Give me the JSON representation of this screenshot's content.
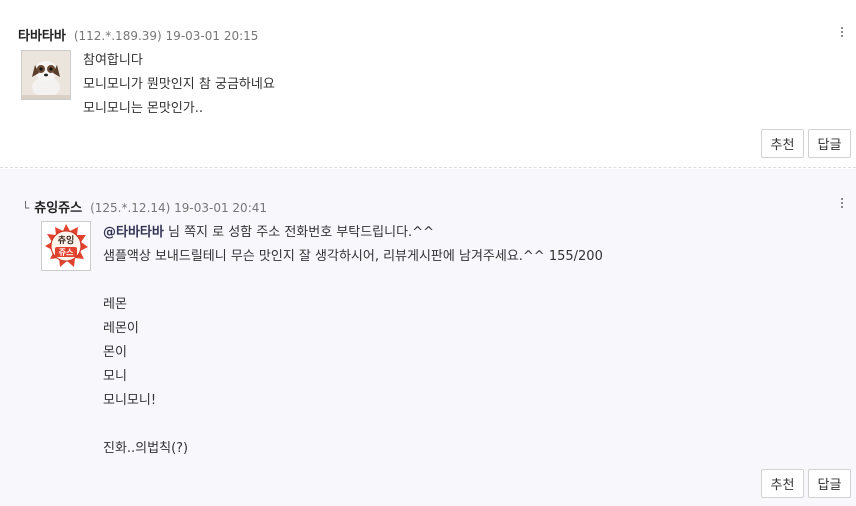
{
  "comments": [
    {
      "author": "타바타바",
      "meta": "(112.*.189.39) 19-03-01 20:15",
      "lines": [
        "참여합니다",
        "모니모니가 뭔맛인지 참 궁금하네요",
        "모니모니는 몬맛인가.."
      ],
      "recommend_label": "추천",
      "reply_label": "답글"
    },
    {
      "reply_marker": "└",
      "author": "츄잉쥬스",
      "meta": "(125.*.12.14) 19-03-01 20:41",
      "avatar_text_top": "츄잉",
      "avatar_text_bottom": "쥬스",
      "mention": "@타바타바",
      "first_line_rest": " 님 쪽지 로 성함 주소 전화번호 부탁드립니다.^^",
      "lines": [
        "샘플액상 보내드릴테니 무슨 맛인지 잘 생각하시어, 리뷰게시판에 남겨주세요.^^ 155/200",
        "",
        "레몬",
        "레몬이",
        "몬이",
        "모니",
        "모니모니!",
        "",
        "진화..의법칙(?)"
      ],
      "recommend_label": "추천",
      "reply_label": "답글"
    }
  ]
}
